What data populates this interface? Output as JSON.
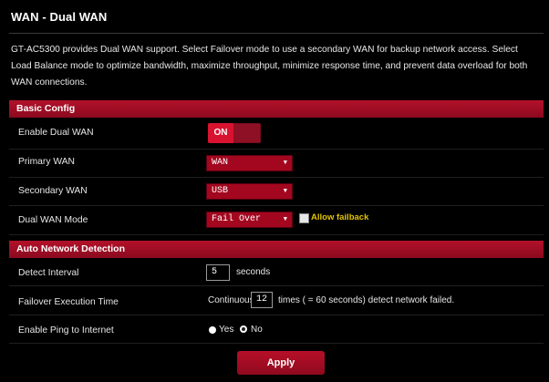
{
  "page": {
    "title": "WAN - Dual WAN",
    "description": "GT-AC5300 provides Dual WAN support. Select Failover mode to use a secondary WAN for backup network access. Select Load Balance mode to optimize bandwidth, maximize throughput, minimize response time, and prevent data overload for both WAN connections."
  },
  "basic_config": {
    "header": "Basic Config",
    "enable_dual_wan": {
      "label": "Enable Dual WAN",
      "toggle_text": "ON",
      "on": true
    },
    "primary_wan": {
      "label": "Primary WAN",
      "value": "WAN"
    },
    "secondary_wan": {
      "label": "Secondary WAN",
      "value": "USB"
    },
    "dual_wan_mode": {
      "label": "Dual WAN Mode",
      "value": "Fail Over",
      "allow_failback_label": "Allow failback",
      "allow_failback_checked": false
    }
  },
  "auto_detection": {
    "header": "Auto Network Detection",
    "detect_interval": {
      "label": "Detect Interval",
      "value": "5",
      "unit": "seconds"
    },
    "failover_time": {
      "label": "Failover Execution Time",
      "prefix": "Continuous",
      "value": "12",
      "suffix": "times ( = 60  seconds) detect network failed."
    },
    "ping": {
      "label": "Enable Ping to Internet",
      "yes_label": "Yes",
      "no_label": "No",
      "selected": "No"
    }
  },
  "actions": {
    "apply_label": "Apply"
  },
  "colors": {
    "accent": "#a3071f",
    "background": "#000000",
    "link": "#e3c300"
  }
}
